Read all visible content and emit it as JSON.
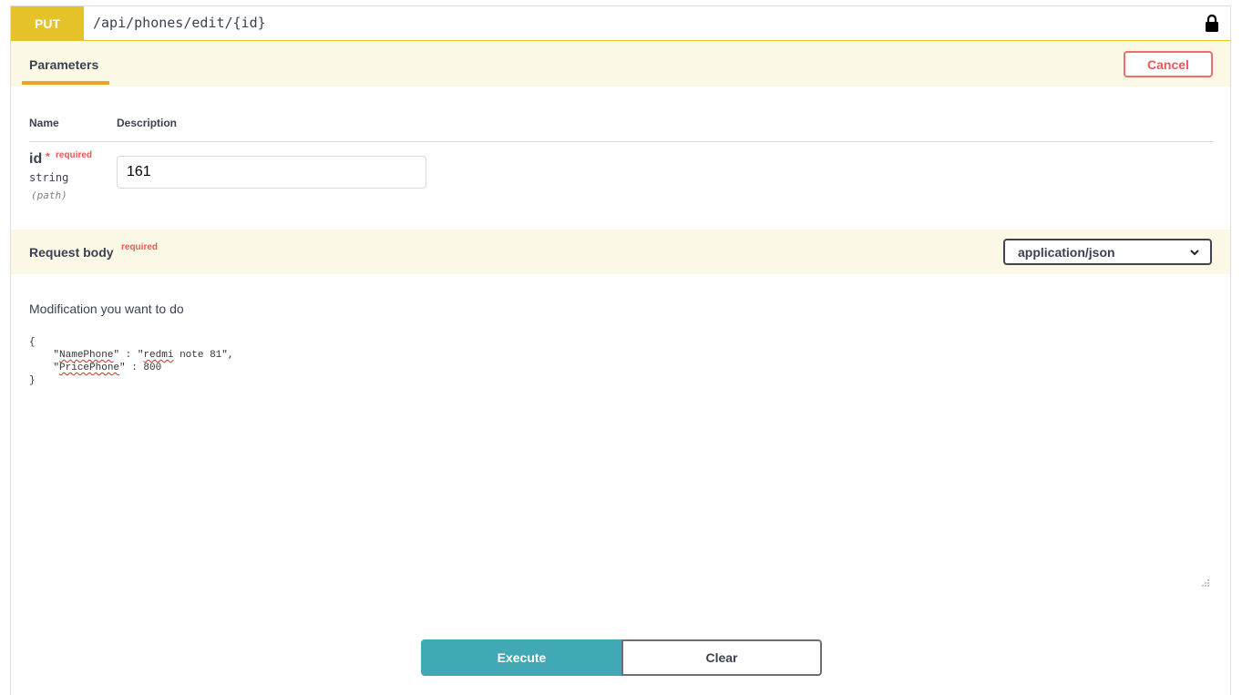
{
  "summary": {
    "method": "PUT",
    "path": "/api/phones/edit/{id}",
    "lock_icon": "lock-icon"
  },
  "tabs": {
    "parameters_label": "Parameters",
    "cancel_label": "Cancel"
  },
  "parameters": {
    "col_name": "Name",
    "col_description": "Description",
    "items": [
      {
        "name": "id",
        "star": "*",
        "required_label": "required",
        "type": "string",
        "in": "(path)",
        "value": "161"
      }
    ]
  },
  "request_body": {
    "title": "Request body",
    "required_label": "required",
    "content_type": "application/json",
    "description": "Modification you want to do",
    "lines": [
      {
        "pre": "{",
        "key": "",
        "post": ""
      },
      {
        "pre": "    \"",
        "key": "NamePhone",
        "post": "\" : \"",
        "key2": "redmi",
        "post2": " note 81\","
      },
      {
        "pre": "    \"",
        "key": "PricePhone",
        "post": "\" : 800"
      },
      {
        "pre": "}",
        "key": "",
        "post": ""
      }
    ]
  },
  "actions": {
    "execute_label": "Execute",
    "clear_label": "Clear"
  },
  "colors": {
    "put": "#e6c229",
    "execute": "#41a9b5",
    "cancel": "#ee6e6e",
    "required": "#ee5555"
  }
}
